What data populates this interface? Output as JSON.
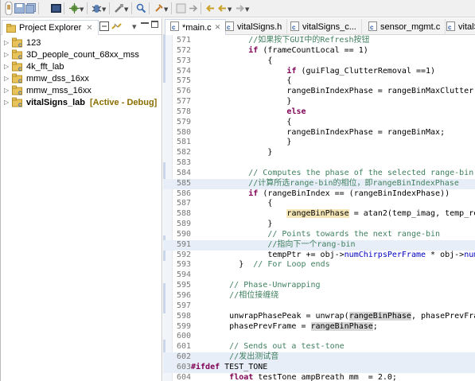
{
  "toolbar": {
    "icons": [
      "debug-perspective-icon",
      "save-icon",
      "save-all-icon",
      "terminal-icon",
      "build-icon",
      "debug-icon",
      "external-tools-icon",
      "search-icon",
      "next-annotation-icon",
      "back-icon",
      "forward-icon"
    ]
  },
  "project_explorer": {
    "title": "Project Explorer",
    "items": [
      {
        "name": "123",
        "tag": ""
      },
      {
        "name": "3D_people_count_68xx_mss",
        "tag": ""
      },
      {
        "name": "4k_fft_lab",
        "tag": ""
      },
      {
        "name": "mmw_dss_16xx",
        "tag": ""
      },
      {
        "name": "mmw_mss_16xx",
        "tag": ""
      },
      {
        "name": "vitalSigns_lab",
        "tag": "[Active - Debug]"
      }
    ]
  },
  "editor_tabs": [
    {
      "label": "*main.c",
      "active": true
    },
    {
      "label": "vitalSigns.h",
      "active": false
    },
    {
      "label": "vitalSigns_c...",
      "active": false
    },
    {
      "label": "sensor_mgmt.c",
      "active": false
    },
    {
      "label": "vitalS",
      "active": false
    }
  ],
  "code_lines": [
    {
      "n": "571",
      "t": "            //如果按下GUI中的Refresh按钮"
    },
    {
      "n": "572",
      "t": "            if (frameCountLocal == 1)"
    },
    {
      "n": "573",
      "t": "                {"
    },
    {
      "n": "574",
      "t": "                    if (guiFlag_ClutterRemoval ==1)"
    },
    {
      "n": "575",
      "t": "                    {"
    },
    {
      "n": "576",
      "t": "                    rangeBinIndexPhase = rangeBinMaxClutter;"
    },
    {
      "n": "577",
      "t": "                    }"
    },
    {
      "n": "578",
      "t": "                    else"
    },
    {
      "n": "579",
      "t": "                    {"
    },
    {
      "n": "580",
      "t": "                    rangeBinIndexPhase = rangeBinMax;"
    },
    {
      "n": "581",
      "t": "                    }"
    },
    {
      "n": "582",
      "t": "                }"
    },
    {
      "n": "583",
      "t": ""
    },
    {
      "n": "584",
      "t": "            // Computes the phase of the selected range-bin i.e. rang"
    },
    {
      "n": "585",
      "t": "            //计算所选range-bin的相位，即rangeBinIndexPhase"
    },
    {
      "n": "586",
      "t": "            if (rangeBinIndex == (rangeBinIndexPhase))"
    },
    {
      "n": "587",
      "t": "                {"
    },
    {
      "n": "588",
      "t": "                    rangeBinPhase = atan2(temp_imag, temp_real);"
    },
    {
      "n": "589",
      "t": "                }"
    },
    {
      "n": "590",
      "t": "                // Points towards the next range-bin"
    },
    {
      "n": "591",
      "t": "                //指向下一个rang-bin"
    },
    {
      "n": "592",
      "t": "                tempPtr += obj->numChirpsPerFrame * obj->numRxAntennas"
    },
    {
      "n": "593",
      "t": "          }  // For Loop ends"
    },
    {
      "n": "594",
      "t": ""
    },
    {
      "n": "595",
      "t": "        // Phase-Unwrapping"
    },
    {
      "n": "596",
      "t": "        //相位接缠绕"
    },
    {
      "n": "597",
      "t": ""
    },
    {
      "n": "598",
      "t": "        unwrapPhasePeak = unwrap(rangeBinPhase, phasePrevFrame, &di"
    },
    {
      "n": "599",
      "t": "        phasePrevFrame = rangeBinPhase;"
    },
    {
      "n": "600",
      "t": ""
    },
    {
      "n": "601",
      "t": "        // Sends out a test-tone"
    },
    {
      "n": "602",
      "t": "        //发出测试音"
    },
    {
      "n": "603",
      "t": "#ifdef TEST_TONE"
    },
    {
      "n": "604",
      "t": "        float testTone_ampBreath_mm  = 2.0;"
    }
  ]
}
